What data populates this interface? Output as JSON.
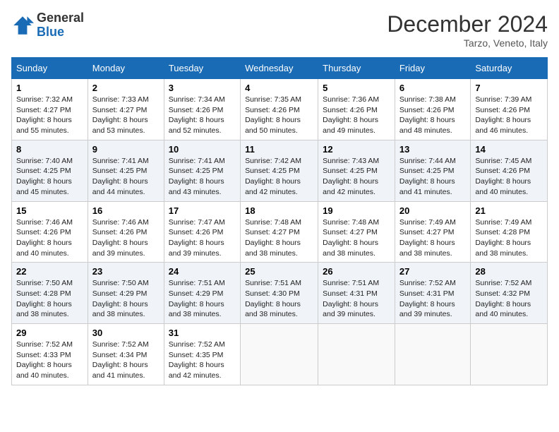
{
  "header": {
    "logo_line1": "General",
    "logo_line2": "Blue",
    "month": "December 2024",
    "location": "Tarzo, Veneto, Italy"
  },
  "weekdays": [
    "Sunday",
    "Monday",
    "Tuesday",
    "Wednesday",
    "Thursday",
    "Friday",
    "Saturday"
  ],
  "weeks": [
    [
      {
        "day": "1",
        "sunrise": "7:32 AM",
        "sunset": "4:27 PM",
        "daylight": "8 hours and 55 minutes."
      },
      {
        "day": "2",
        "sunrise": "7:33 AM",
        "sunset": "4:27 PM",
        "daylight": "8 hours and 53 minutes."
      },
      {
        "day": "3",
        "sunrise": "7:34 AM",
        "sunset": "4:26 PM",
        "daylight": "8 hours and 52 minutes."
      },
      {
        "day": "4",
        "sunrise": "7:35 AM",
        "sunset": "4:26 PM",
        "daylight": "8 hours and 50 minutes."
      },
      {
        "day": "5",
        "sunrise": "7:36 AM",
        "sunset": "4:26 PM",
        "daylight": "8 hours and 49 minutes."
      },
      {
        "day": "6",
        "sunrise": "7:38 AM",
        "sunset": "4:26 PM",
        "daylight": "8 hours and 48 minutes."
      },
      {
        "day": "7",
        "sunrise": "7:39 AM",
        "sunset": "4:26 PM",
        "daylight": "8 hours and 46 minutes."
      }
    ],
    [
      {
        "day": "8",
        "sunrise": "7:40 AM",
        "sunset": "4:25 PM",
        "daylight": "8 hours and 45 minutes."
      },
      {
        "day": "9",
        "sunrise": "7:41 AM",
        "sunset": "4:25 PM",
        "daylight": "8 hours and 44 minutes."
      },
      {
        "day": "10",
        "sunrise": "7:41 AM",
        "sunset": "4:25 PM",
        "daylight": "8 hours and 43 minutes."
      },
      {
        "day": "11",
        "sunrise": "7:42 AM",
        "sunset": "4:25 PM",
        "daylight": "8 hours and 42 minutes."
      },
      {
        "day": "12",
        "sunrise": "7:43 AM",
        "sunset": "4:25 PM",
        "daylight": "8 hours and 42 minutes."
      },
      {
        "day": "13",
        "sunrise": "7:44 AM",
        "sunset": "4:25 PM",
        "daylight": "8 hours and 41 minutes."
      },
      {
        "day": "14",
        "sunrise": "7:45 AM",
        "sunset": "4:26 PM",
        "daylight": "8 hours and 40 minutes."
      }
    ],
    [
      {
        "day": "15",
        "sunrise": "7:46 AM",
        "sunset": "4:26 PM",
        "daylight": "8 hours and 40 minutes."
      },
      {
        "day": "16",
        "sunrise": "7:46 AM",
        "sunset": "4:26 PM",
        "daylight": "8 hours and 39 minutes."
      },
      {
        "day": "17",
        "sunrise": "7:47 AM",
        "sunset": "4:26 PM",
        "daylight": "8 hours and 39 minutes."
      },
      {
        "day": "18",
        "sunrise": "7:48 AM",
        "sunset": "4:27 PM",
        "daylight": "8 hours and 38 minutes."
      },
      {
        "day": "19",
        "sunrise": "7:48 AM",
        "sunset": "4:27 PM",
        "daylight": "8 hours and 38 minutes."
      },
      {
        "day": "20",
        "sunrise": "7:49 AM",
        "sunset": "4:27 PM",
        "daylight": "8 hours and 38 minutes."
      },
      {
        "day": "21",
        "sunrise": "7:49 AM",
        "sunset": "4:28 PM",
        "daylight": "8 hours and 38 minutes."
      }
    ],
    [
      {
        "day": "22",
        "sunrise": "7:50 AM",
        "sunset": "4:28 PM",
        "daylight": "8 hours and 38 minutes."
      },
      {
        "day": "23",
        "sunrise": "7:50 AM",
        "sunset": "4:29 PM",
        "daylight": "8 hours and 38 minutes."
      },
      {
        "day": "24",
        "sunrise": "7:51 AM",
        "sunset": "4:29 PM",
        "daylight": "8 hours and 38 minutes."
      },
      {
        "day": "25",
        "sunrise": "7:51 AM",
        "sunset": "4:30 PM",
        "daylight": "8 hours and 38 minutes."
      },
      {
        "day": "26",
        "sunrise": "7:51 AM",
        "sunset": "4:31 PM",
        "daylight": "8 hours and 39 minutes."
      },
      {
        "day": "27",
        "sunrise": "7:52 AM",
        "sunset": "4:31 PM",
        "daylight": "8 hours and 39 minutes."
      },
      {
        "day": "28",
        "sunrise": "7:52 AM",
        "sunset": "4:32 PM",
        "daylight": "8 hours and 40 minutes."
      }
    ],
    [
      {
        "day": "29",
        "sunrise": "7:52 AM",
        "sunset": "4:33 PM",
        "daylight": "8 hours and 40 minutes."
      },
      {
        "day": "30",
        "sunrise": "7:52 AM",
        "sunset": "4:34 PM",
        "daylight": "8 hours and 41 minutes."
      },
      {
        "day": "31",
        "sunrise": "7:52 AM",
        "sunset": "4:35 PM",
        "daylight": "8 hours and 42 minutes."
      },
      null,
      null,
      null,
      null
    ]
  ],
  "labels": {
    "sunrise": "Sunrise:",
    "sunset": "Sunset:",
    "daylight": "Daylight:"
  }
}
